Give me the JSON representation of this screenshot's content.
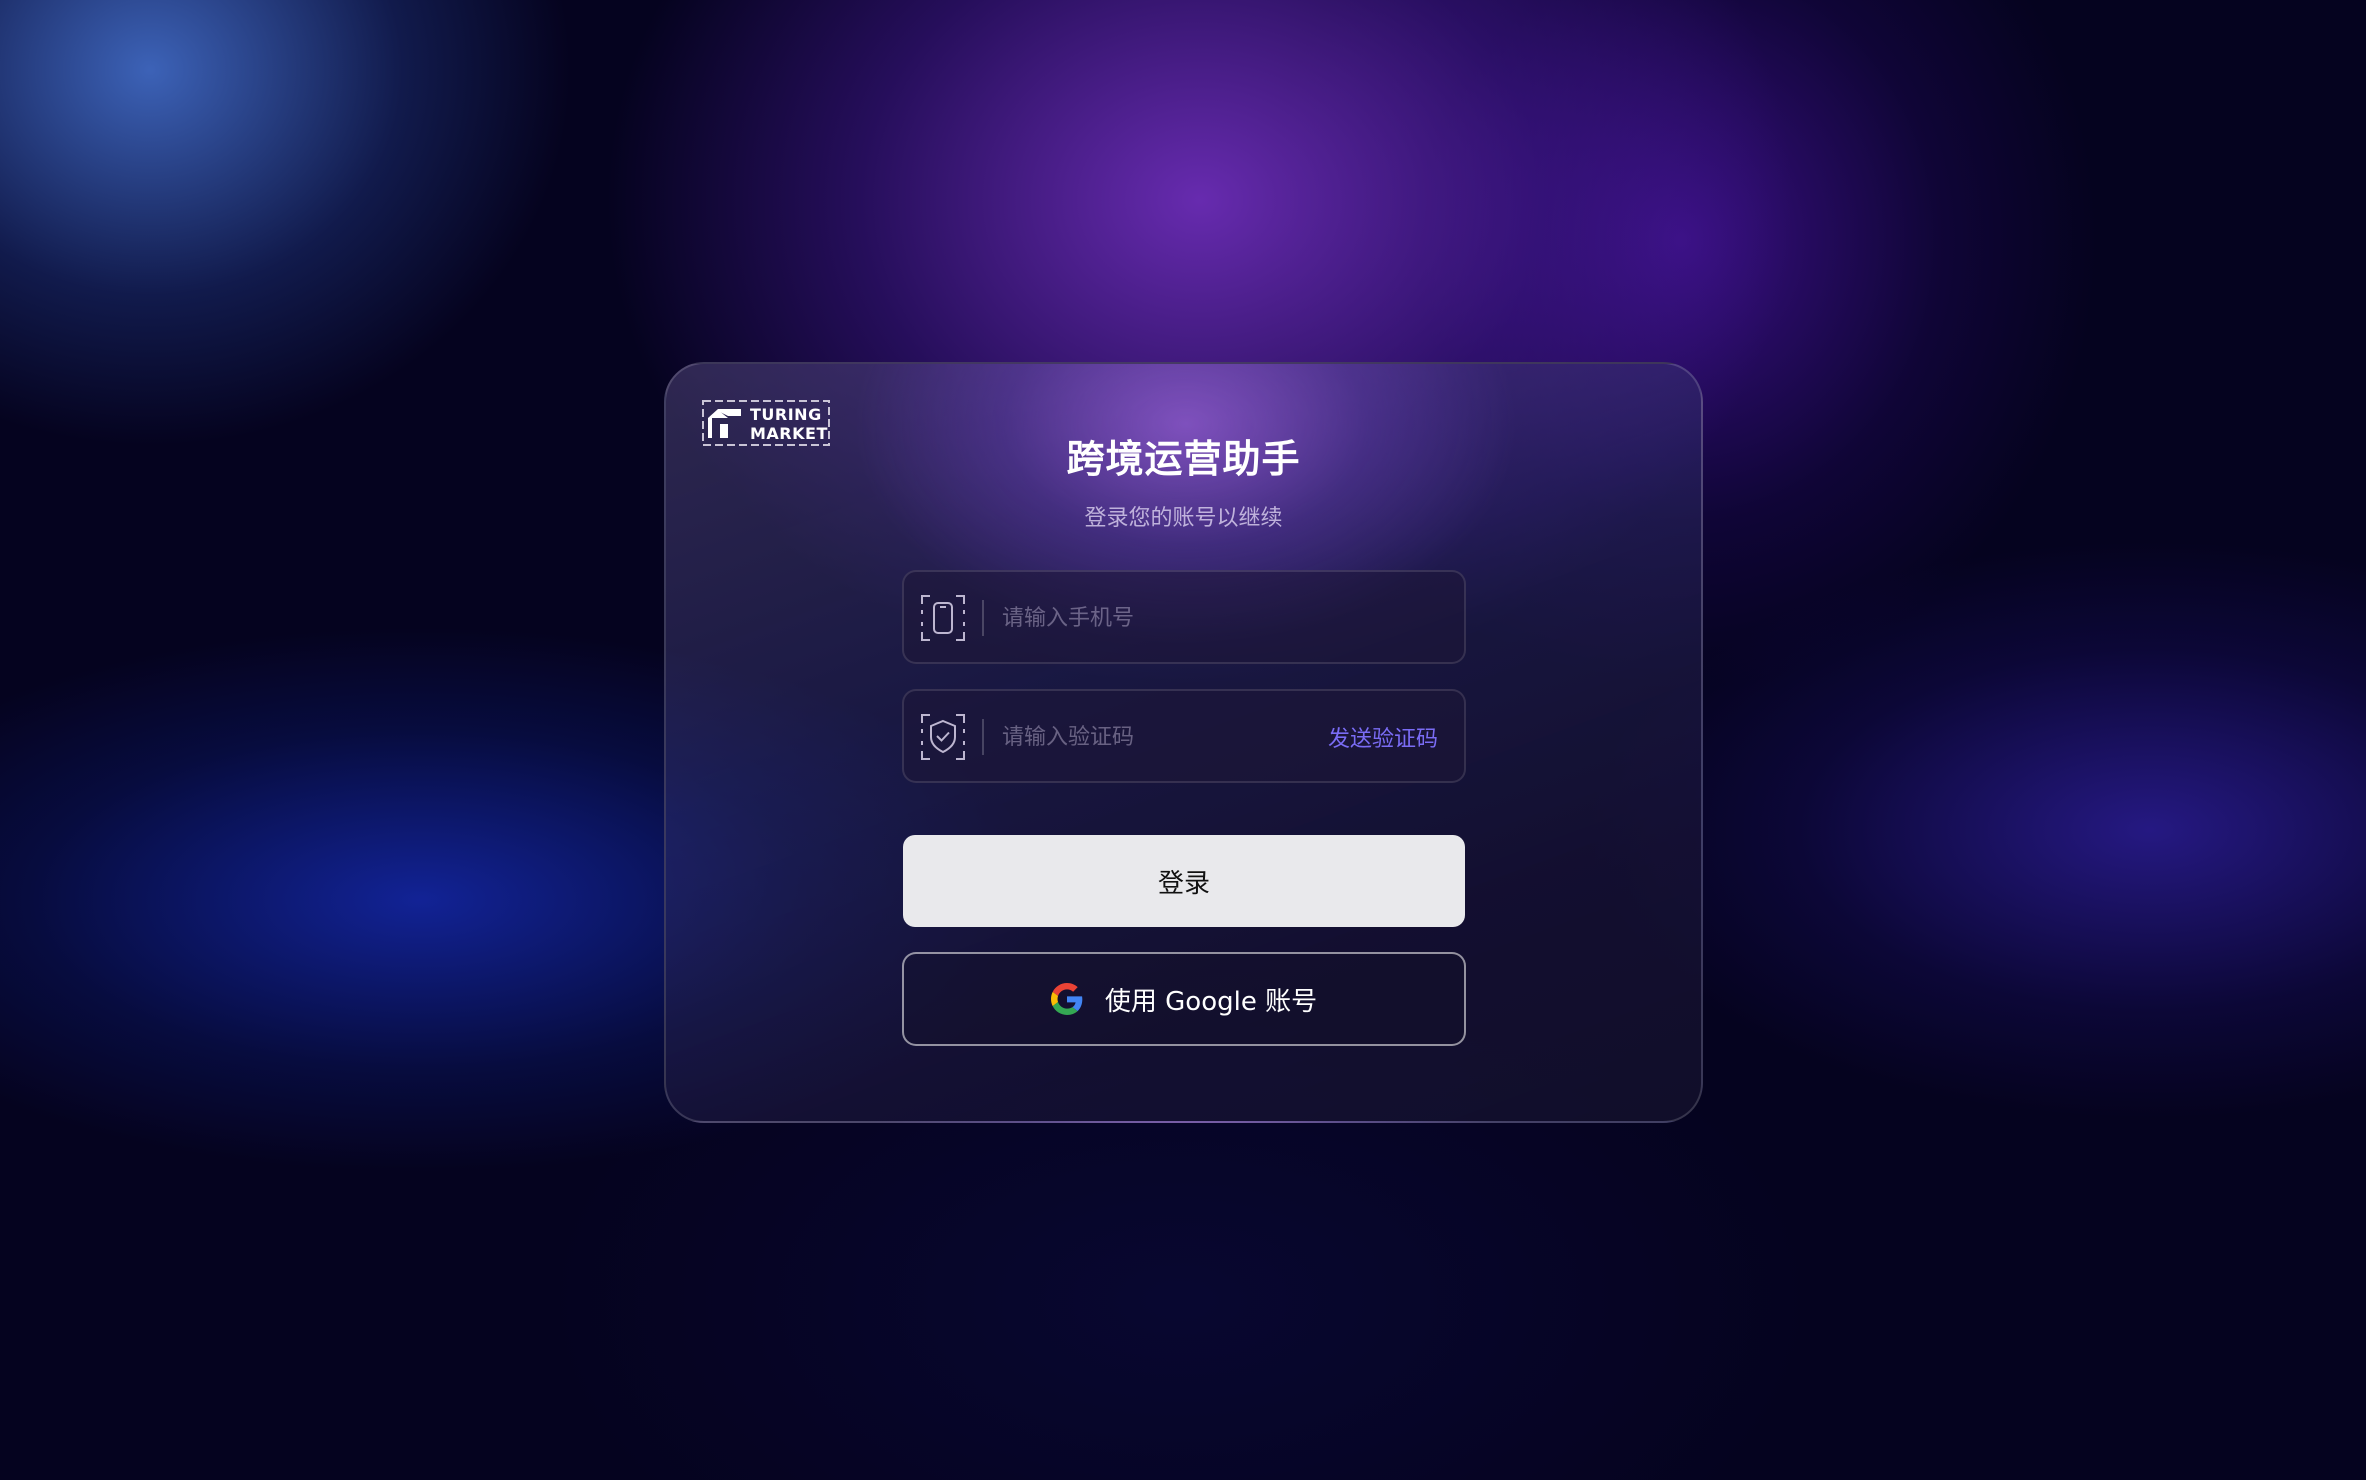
{
  "logo": {
    "line1": "TURING",
    "line2": "MARKET"
  },
  "title": "跨境运营助手",
  "subtitle": "登录您的账号以继续",
  "phone": {
    "placeholder": "请输入手机号",
    "value": "",
    "icon": "phone-icon"
  },
  "code": {
    "placeholder": "请输入验证码",
    "value": "",
    "icon": "shield-check-icon",
    "send_label": "发送验证码"
  },
  "login_button": "登录",
  "google_button": {
    "label": "使用 Google 账号",
    "icon": "google-icon"
  },
  "colors": {
    "accent": "#7a6cf5",
    "button_bg": "#e9e9ec",
    "background": "#05031f"
  }
}
